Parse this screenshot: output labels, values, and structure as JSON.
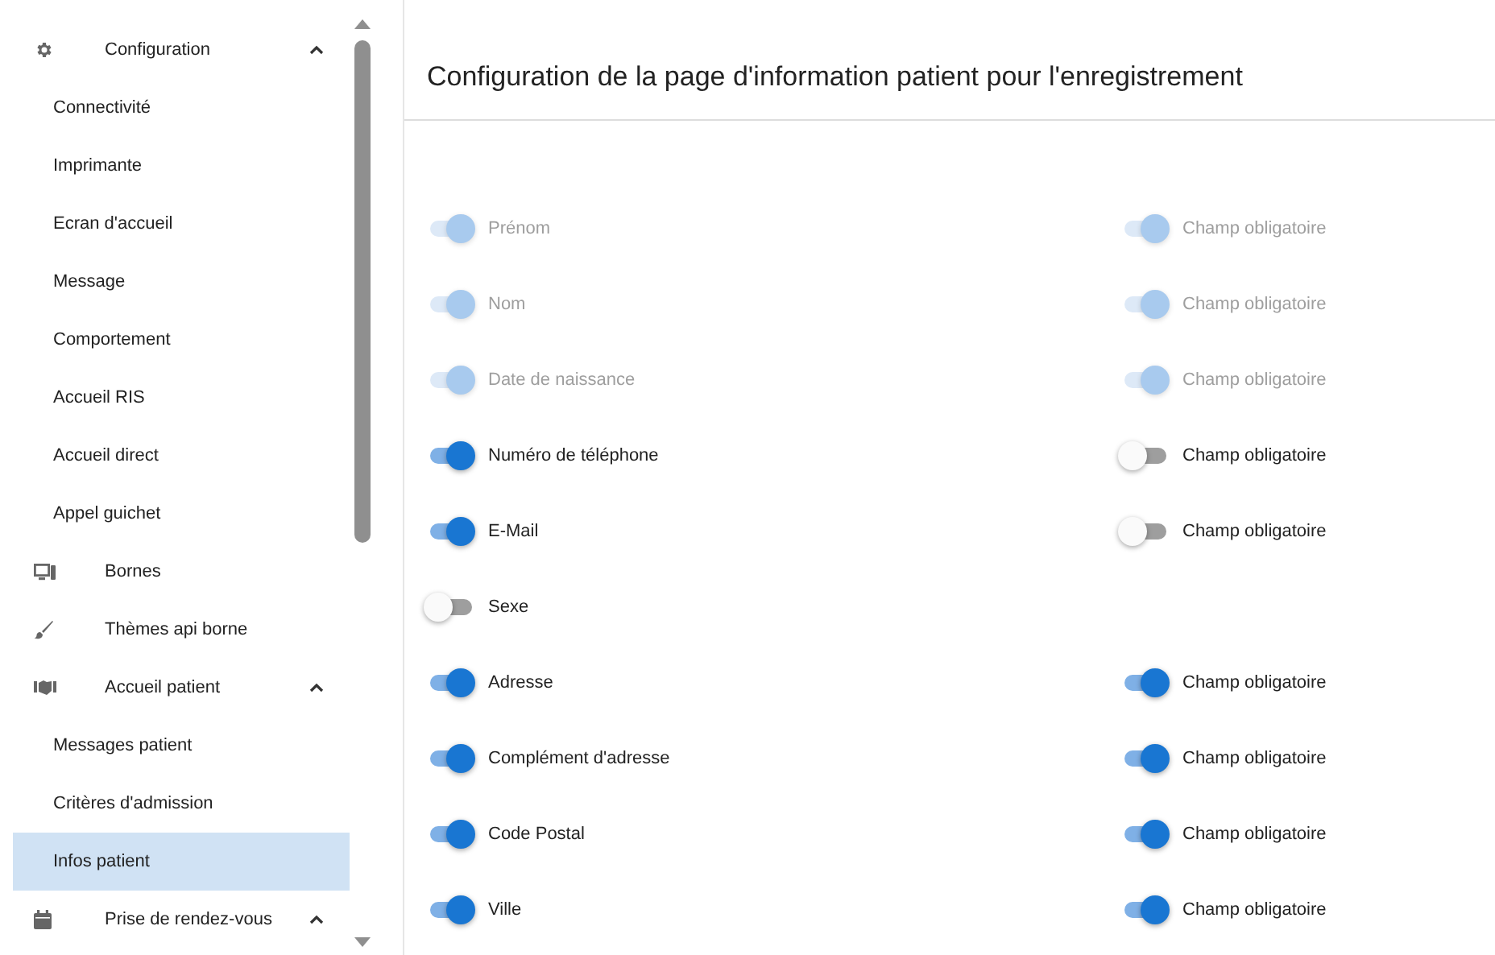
{
  "sidebar": {
    "items": [
      {
        "kind": "group",
        "label": "Configuration",
        "expanded": true,
        "selected": false
      },
      {
        "kind": "sub",
        "label": "Connectivité",
        "selected": false
      },
      {
        "kind": "sub",
        "label": "Imprimante",
        "selected": false
      },
      {
        "kind": "sub",
        "label": "Ecran d'accueil",
        "selected": false
      },
      {
        "kind": "sub",
        "label": "Message",
        "selected": false
      },
      {
        "kind": "sub",
        "label": "Comportement",
        "selected": false
      },
      {
        "kind": "sub",
        "label": "Accueil RIS",
        "selected": false
      },
      {
        "kind": "sub",
        "label": "Accueil direct",
        "selected": false
      },
      {
        "kind": "sub",
        "label": "Appel guichet",
        "selected": false
      },
      {
        "kind": "link",
        "label": "Bornes",
        "selected": false
      },
      {
        "kind": "link",
        "label": "Thèmes api borne",
        "selected": false
      },
      {
        "kind": "group",
        "label": "Accueil patient",
        "expanded": true,
        "selected": false
      },
      {
        "kind": "sub",
        "label": "Messages patient",
        "selected": false
      },
      {
        "kind": "sub",
        "label": "Critères d'admission",
        "selected": false
      },
      {
        "kind": "sub",
        "label": "Infos patient",
        "selected": true
      },
      {
        "kind": "group",
        "label": "Prise de rendez-vous",
        "expanded": true,
        "selected": false
      }
    ]
  },
  "page": {
    "title": "Configuration de la page d'information patient pour l'enregistrement"
  },
  "fields": [
    {
      "label": "Prénom",
      "on": true,
      "disabled": true,
      "required": {
        "label": "Champ obligatoire",
        "on": true,
        "disabled": true
      }
    },
    {
      "label": "Nom",
      "on": true,
      "disabled": true,
      "required": {
        "label": "Champ obligatoire",
        "on": true,
        "disabled": true
      }
    },
    {
      "label": "Date de naissance",
      "on": true,
      "disabled": true,
      "required": {
        "label": "Champ obligatoire",
        "on": true,
        "disabled": true
      }
    },
    {
      "label": "Numéro de téléphone",
      "on": true,
      "disabled": false,
      "required": {
        "label": "Champ obligatoire",
        "on": false,
        "disabled": false
      }
    },
    {
      "label": "E-Mail",
      "on": true,
      "disabled": false,
      "required": {
        "label": "Champ obligatoire",
        "on": false,
        "disabled": false
      }
    },
    {
      "label": "Sexe",
      "on": false,
      "disabled": false
    },
    {
      "label": "Adresse",
      "on": true,
      "disabled": false,
      "required": {
        "label": "Champ obligatoire",
        "on": true,
        "disabled": false
      }
    },
    {
      "label": "Complément d'adresse",
      "on": true,
      "disabled": false,
      "required": {
        "label": "Champ obligatoire",
        "on": true,
        "disabled": false
      }
    },
    {
      "label": "Code Postal",
      "on": true,
      "disabled": false,
      "required": {
        "label": "Champ obligatoire",
        "on": true,
        "disabled": false
      }
    },
    {
      "label": "Ville",
      "on": true,
      "disabled": false,
      "required": {
        "label": "Champ obligatoire",
        "on": true,
        "disabled": false
      }
    }
  ]
}
